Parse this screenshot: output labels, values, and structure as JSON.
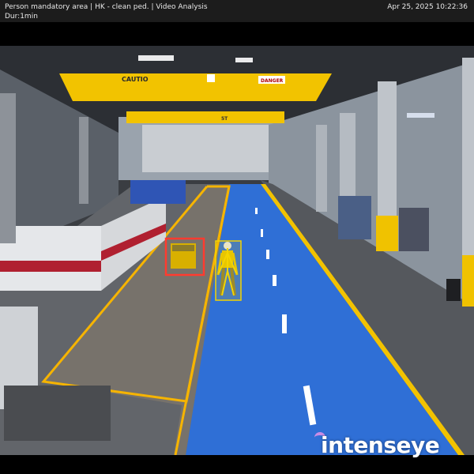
{
  "header": {
    "title": "Person mandatory area | HK - clean ped. | Video Analysis",
    "duration": "Dur:1min",
    "timestamp": "Apr 25, 2025 10:22:36"
  },
  "scene": {
    "crane_front_label": "CAUTIO",
    "crane_front_sign": "DANGER",
    "crane_back_label": "5T"
  },
  "detections": [
    {
      "label": "object",
      "type": "obstacle",
      "color": "#ff3b2f"
    },
    {
      "label": "person",
      "type": "person",
      "color": "#f5d400"
    }
  ],
  "zone": {
    "color": "#f6b400"
  },
  "brand": {
    "name": "intenseye",
    "accent": "#c98ce6"
  }
}
